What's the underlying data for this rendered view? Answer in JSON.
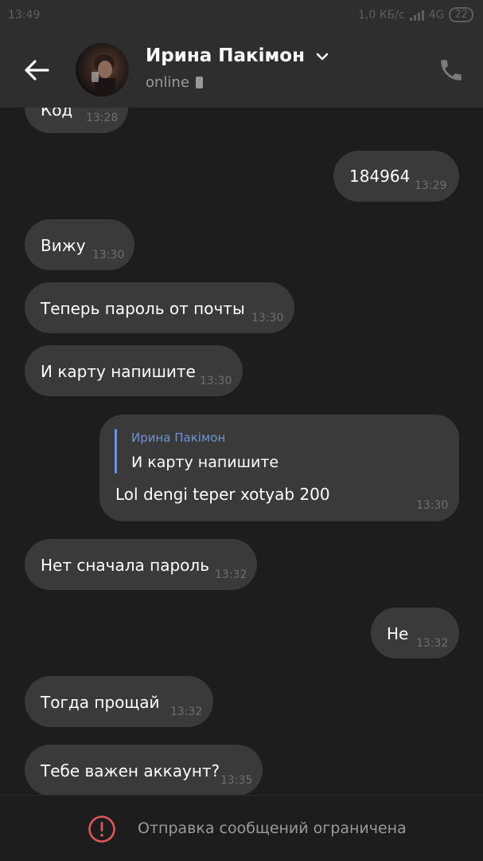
{
  "status_bar": {
    "time": "13:49",
    "network_speed": "1,0 КБ/с",
    "network_type": "4G",
    "battery": "22"
  },
  "header": {
    "contact_name": "Ирина Пакімон",
    "status": "online",
    "icons": {
      "back": "arrow-left-icon",
      "avatar": "avatar",
      "chevron": "chevron-down-icon",
      "device": "phone-device-icon",
      "call": "phone-icon"
    }
  },
  "messages": [
    {
      "direction": "in",
      "text": "Код",
      "time": "13:28"
    },
    {
      "direction": "out",
      "text": "184964",
      "time": "13:29"
    },
    {
      "direction": "in",
      "text": "Вижу",
      "time": "13:30"
    },
    {
      "direction": "in",
      "text": "Теперь пароль от почты",
      "time": "13:30"
    },
    {
      "direction": "in",
      "text": "И карту напишите",
      "time": "13:30"
    },
    {
      "direction": "out",
      "reply_author": "Ирина Пакімон",
      "reply_text": "И карту напишите",
      "text": "Lol dengi teper xotyab 200",
      "time": "13:30"
    },
    {
      "direction": "in",
      "text": "Нет сначала пароль",
      "time": "13:32"
    },
    {
      "direction": "out",
      "text": "Не",
      "time": "13:32"
    },
    {
      "direction": "in",
      "text": "Тогда прощай",
      "time": "13:32"
    },
    {
      "direction": "in",
      "text": "Тебе важен аккаунт?",
      "time": "13:35"
    }
  ],
  "footer": {
    "restriction_text": "Отправка сообщений ограничена",
    "icon": "alert-circle-icon"
  },
  "colors": {
    "background": "#1d1d1d",
    "header": "#2e2e2e",
    "bubble": "#3a3a3a",
    "reply_accent": "#6d95d8",
    "alert": "#e05555"
  }
}
